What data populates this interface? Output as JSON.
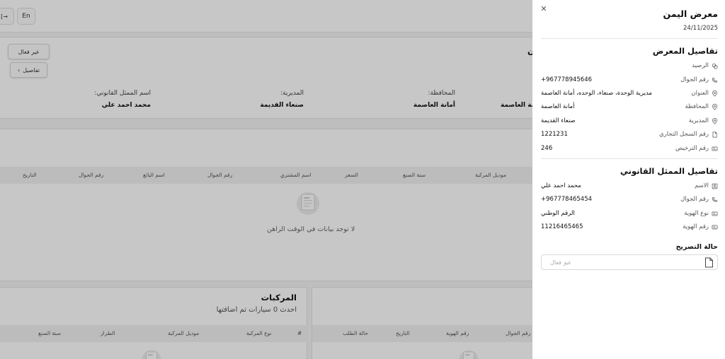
{
  "topbar": {
    "lang_label": "En",
    "logout_icon": "logout-icon"
  },
  "showroom_card": {
    "name_partial": "ن",
    "deactivate_label": "غير فعال",
    "details_label": "تفاصيل",
    "fields": [
      {
        "label": "اسم الممثل القانوني:",
        "value": "محمد احمد علي"
      },
      {
        "label": "المديرية:",
        "value": "صنعاء القديمة"
      },
      {
        "label": "المحافظة:",
        "value": "أمانة العاصمة"
      },
      {
        "label": "",
        "value": "أمانة العاصمة"
      }
    ]
  },
  "sales_table": {
    "columns": [
      "موديل المركبة",
      "سنة الصنع",
      "السعر",
      "اسم المشتري",
      "رقم الجوال",
      "اسم البائع",
      "رقم الجوال",
      "التاريخ"
    ],
    "empty_text": "لا توجد بيانات في الوقت الراهن"
  },
  "vehicles": {
    "title": "المركبات",
    "subtitle": "احدث 0 سيارات تم اضافتها",
    "columns": [
      "#",
      "نوع المركبة",
      "موديل المركبة",
      "الطراز",
      "سنة الصنع"
    ]
  },
  "requests_table": {
    "columns": [
      "رقم الجوال",
      "رقم الهوية",
      "التاريخ",
      "حالة الطلب"
    ]
  },
  "drawer": {
    "title": "معرض اليمن",
    "date": "24/11/2025",
    "close_icon": "close-icon",
    "showroom_section": "تفاصيل المعرض",
    "showroom_rows": [
      {
        "label": "الرصيد",
        "value": "",
        "icon": "coins-icon"
      },
      {
        "label": "رقم الجوال",
        "value": "+967778945646",
        "icon": "phone-icon"
      },
      {
        "label": "العنوان",
        "value": "مديرية الوحدة، صنعاء، الوحده، أمانة العاصمة",
        "icon": "location-icon"
      },
      {
        "label": "المحافظة",
        "value": "أمانة العاصمة",
        "icon": "location-icon"
      },
      {
        "label": "المديرية",
        "value": "صنعاء القديمة",
        "icon": "location-icon"
      },
      {
        "label": "رقم السجل التجاري",
        "value": "1221231",
        "icon": "document-icon"
      },
      {
        "label": "رقم الترخيص",
        "value": "246",
        "icon": "id-card-icon"
      }
    ],
    "rep_section": "تفاصيل الممثل القانوني",
    "rep_rows": [
      {
        "label": "الاسم",
        "value": "محمد احمد علي",
        "icon": "user-icon"
      },
      {
        "label": "رقم الجوال",
        "value": "+967778465454",
        "icon": "phone-icon"
      },
      {
        "label": "نوع الهوية",
        "value": "الرقم الوطني",
        "icon": "id-card-icon"
      },
      {
        "label": "رقم الهوية",
        "value": "11216465465",
        "icon": "id-card-icon"
      }
    ],
    "status_label": "حالة التصريح",
    "status_placeholder": "غير فعال"
  }
}
